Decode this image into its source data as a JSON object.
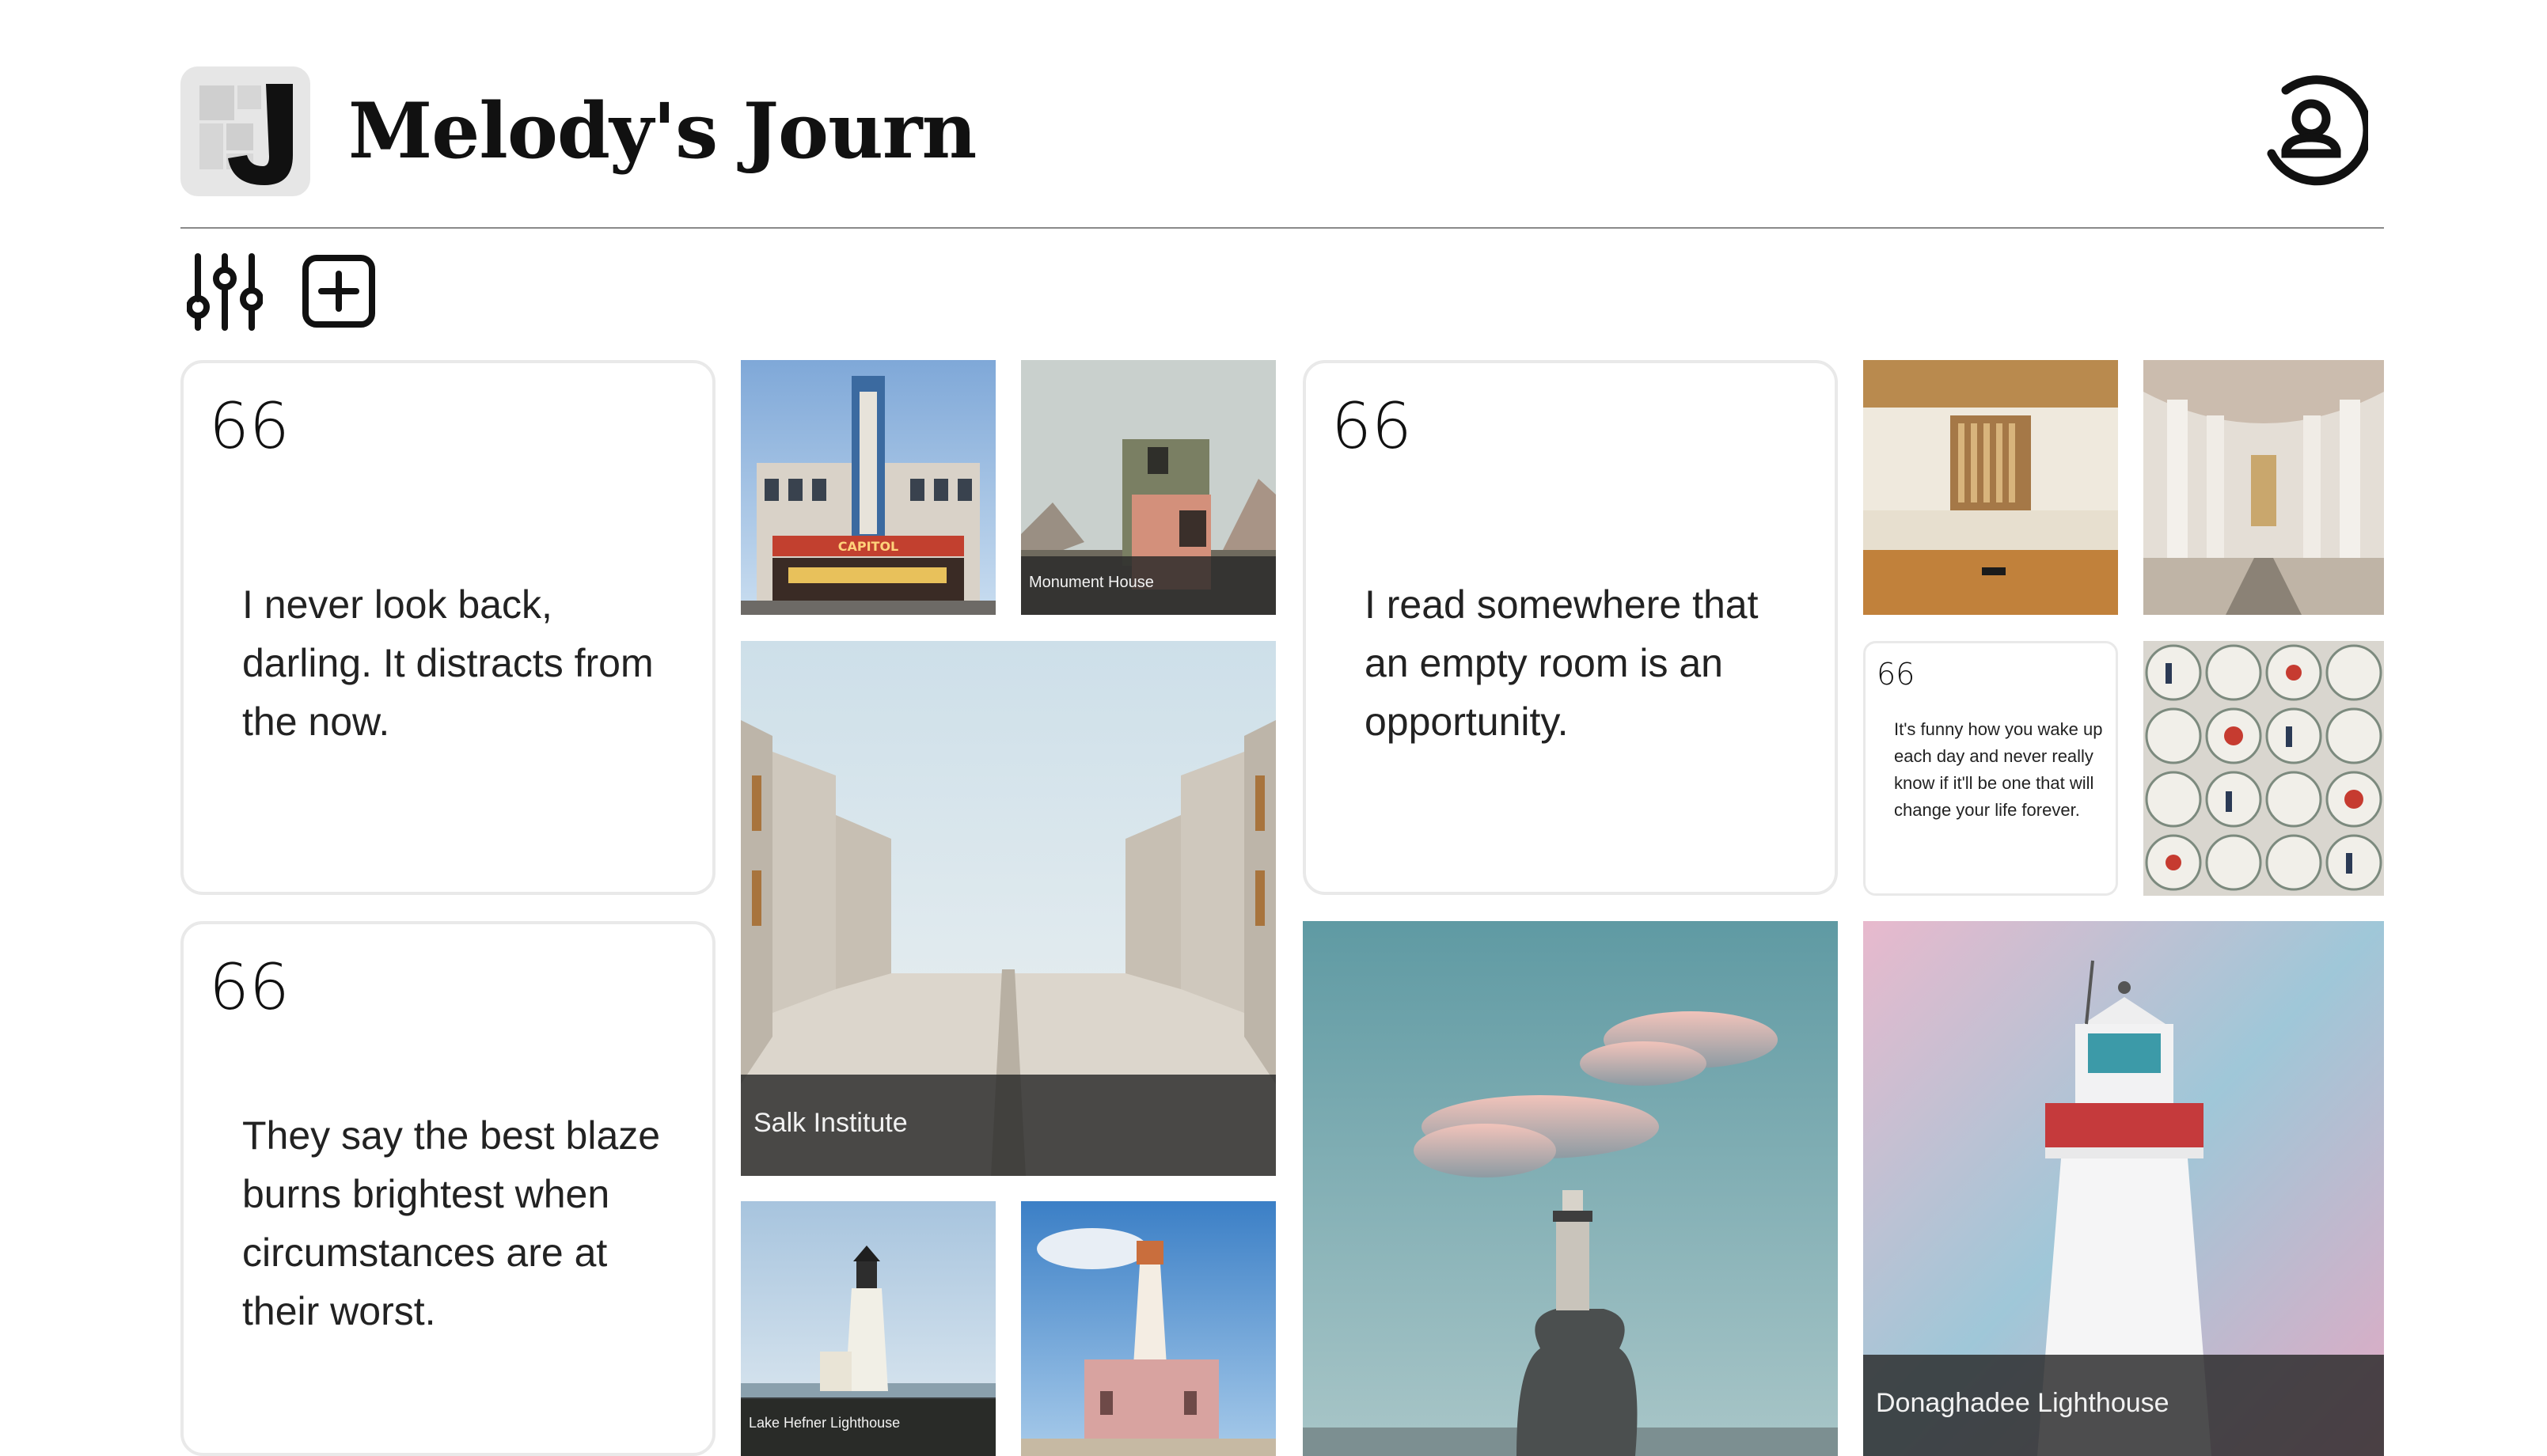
{
  "header": {
    "title": "Melody's Journ",
    "logo_letter": "J",
    "icons": {
      "logo": "journal-logo-icon",
      "profile": "user-circle-icon",
      "filter": "sliders-icon",
      "add": "add-square-icon"
    }
  },
  "quotes": [
    {
      "mark": "66",
      "text": "I never look back, darling. It distracts from the now."
    },
    {
      "mark": "66",
      "text": "They say the best blaze burns brightest when circumstances are at their worst."
    },
    {
      "mark": "66",
      "text": "I read somewhere that an empty room is an opportunity."
    },
    {
      "mark": "66",
      "text": "It's funny how you wake up each day and never really know if it'll be one that will change your life forever."
    }
  ],
  "photos": {
    "capitol": {
      "sign": "CAPITOL"
    },
    "monument": {
      "caption": "Monument House"
    },
    "salk": {
      "caption": "Salk Institute"
    },
    "lake_hefner": {
      "caption": "Lake Hefner Lighthouse"
    },
    "donaghadee": {
      "caption": "Donaghadee Lighthouse"
    }
  },
  "colors": {
    "card_border": "#e9e9e9",
    "caption_bg": "#282828",
    "rule": "#8a8a8a"
  }
}
